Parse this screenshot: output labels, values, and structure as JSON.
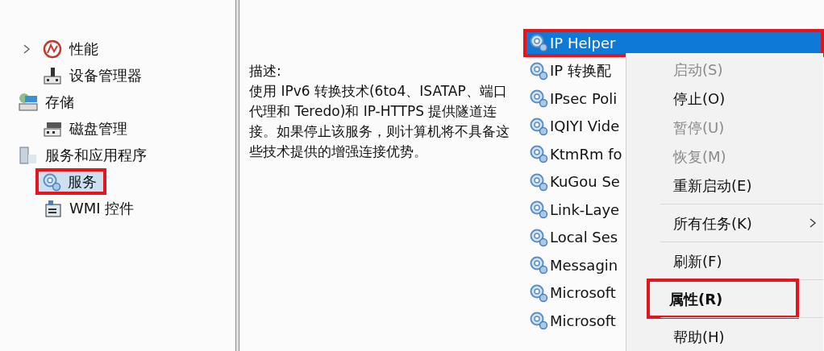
{
  "tree": {
    "continued_children": [
      {
        "label": "性能",
        "expandable": true,
        "selected": false,
        "highlighted": false
      },
      {
        "label": "设备管理器",
        "expandable": false,
        "selected": false,
        "highlighted": false
      }
    ],
    "items": [
      {
        "label": "存储",
        "expandable": false,
        "selected": false,
        "highlighted": false,
        "children": [
          {
            "label": "磁盘管理",
            "expandable": false,
            "selected": false,
            "highlighted": false
          }
        ]
      },
      {
        "label": "服务和应用程序",
        "expandable": false,
        "selected": false,
        "highlighted": false,
        "children": [
          {
            "label": "服务",
            "expandable": false,
            "selected": true,
            "highlighted": true
          },
          {
            "label": "WMI 控件",
            "expandable": false,
            "selected": false,
            "highlighted": false
          }
        ]
      }
    ]
  },
  "description": {
    "label": "描述:",
    "text": "使用 IPv6 转换技术(6to4、ISATAP、端口代理和 Teredo)和 IP-HTTPS 提供隧道连接。如果停止该服务，则计算机将不具备这些技术提供的增强连接优势。"
  },
  "services": [
    {
      "name": "IP Helper",
      "selected": true,
      "highlighted": true
    },
    {
      "name": "IP 转换配",
      "selected": false,
      "highlighted": false
    },
    {
      "name": "IPsec Poli",
      "selected": false,
      "highlighted": false
    },
    {
      "name": "IQIYI Vide",
      "selected": false,
      "highlighted": false
    },
    {
      "name": "KtmRm fo",
      "selected": false,
      "highlighted": false
    },
    {
      "name": "KuGou Se",
      "selected": false,
      "highlighted": false
    },
    {
      "name": "Link-Laye",
      "selected": false,
      "highlighted": false
    },
    {
      "name": "Local Ses",
      "selected": false,
      "highlighted": false
    },
    {
      "name": "Messagin",
      "selected": false,
      "highlighted": false
    },
    {
      "name": "Microsoft",
      "selected": false,
      "highlighted": false
    },
    {
      "name": "Microsoft",
      "selected": false,
      "highlighted": false
    }
  ],
  "context_menu": [
    {
      "kind": "item",
      "label": "启动(S)",
      "disabled": true,
      "default": false,
      "submenu": false,
      "highlighted": false
    },
    {
      "kind": "item",
      "label": "停止(O)",
      "disabled": false,
      "default": false,
      "submenu": false,
      "highlighted": false
    },
    {
      "kind": "item",
      "label": "暂停(U)",
      "disabled": true,
      "default": false,
      "submenu": false,
      "highlighted": false
    },
    {
      "kind": "item",
      "label": "恢复(M)",
      "disabled": true,
      "default": false,
      "submenu": false,
      "highlighted": false
    },
    {
      "kind": "item",
      "label": "重新启动(E)",
      "disabled": false,
      "default": false,
      "submenu": false,
      "highlighted": false
    },
    {
      "kind": "separator"
    },
    {
      "kind": "item",
      "label": "所有任务(K)",
      "disabled": false,
      "default": false,
      "submenu": true,
      "highlighted": false
    },
    {
      "kind": "separator"
    },
    {
      "kind": "item",
      "label": "刷新(F)",
      "disabled": false,
      "default": false,
      "submenu": false,
      "highlighted": false
    },
    {
      "kind": "separator"
    },
    {
      "kind": "item",
      "label": "属性(R)",
      "disabled": false,
      "default": true,
      "submenu": false,
      "highlighted": true
    },
    {
      "kind": "separator"
    },
    {
      "kind": "item",
      "label": "帮助(H)",
      "disabled": false,
      "default": false,
      "submenu": false,
      "highlighted": false
    }
  ]
}
